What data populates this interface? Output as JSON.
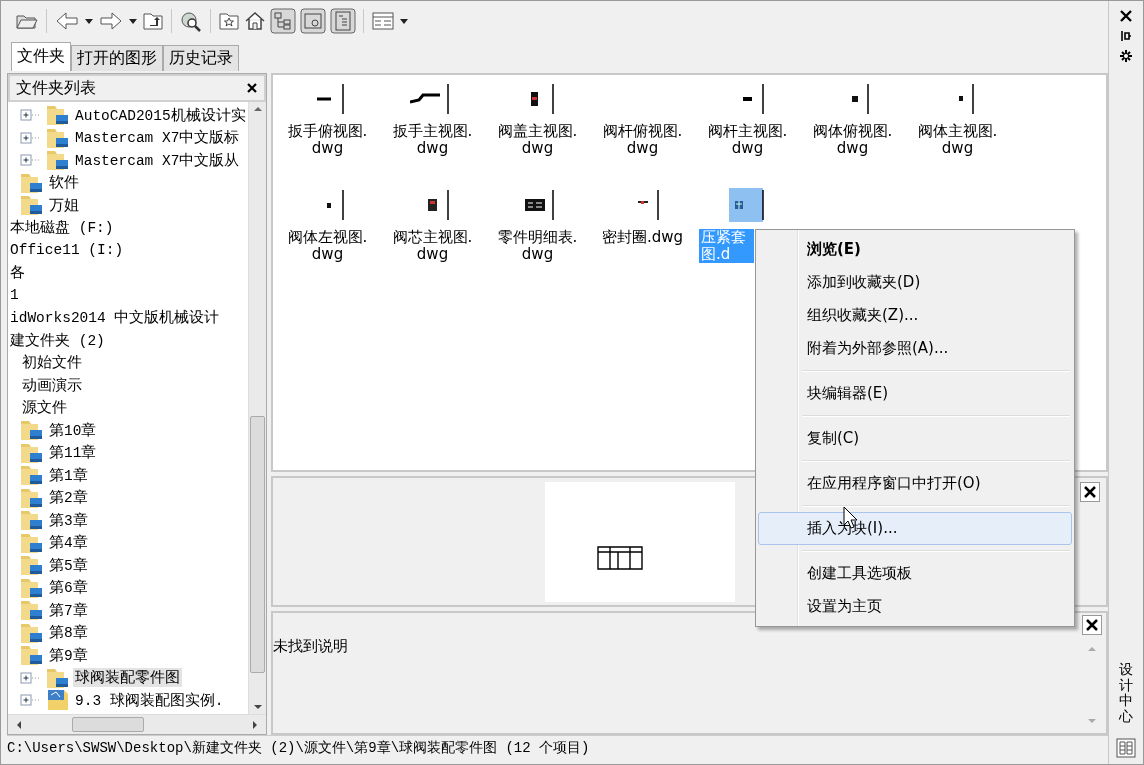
{
  "toolbar": {
    "toggles": [
      {
        "pressed": true
      },
      {
        "pressed": true
      },
      {
        "pressed": true
      }
    ]
  },
  "tabs": [
    {
      "label": "文件夹",
      "selected": true
    },
    {
      "label": "打开的图形",
      "selected": false
    },
    {
      "label": "历史记录",
      "selected": false
    }
  ],
  "folder_pane": {
    "title": "文件夹列表"
  },
  "tree": {
    "items": [
      {
        "children": [
          {
            "children": [
              {
                "children": [
                  {
                    "label": "AutoCAD2015机械设计实",
                    "kind": "folder",
                    "expandable": true,
                    "selected": false
                  },
                  {
                    "label": "Mastercam X7中文版标",
                    "kind": "folder",
                    "expandable": true,
                    "selected": false
                  },
                  {
                    "label": "Mastercam X7中文版从",
                    "kind": "folder",
                    "expandable": true,
                    "selected": false
                  }
                ]
              },
              {
                "label": "软件",
                "kind": "folder",
                "selected": false
              },
              {
                "label": "万姐",
                "kind": "folder",
                "selected": false
              }
            ]
          }
        ]
      },
      {
        "label": "本地磁盘 (F:)",
        "selected": false
      },
      {
        "label": "Office11 (I:)",
        "selected": false
      },
      {
        "label": "各",
        "selected": false
      },
      {
        "label": "1",
        "selected": false
      },
      {
        "label": "idWorks2014 中文版机械设计",
        "selected": false
      },
      {
        "label": "建文件夹 (2)",
        "selected": false,
        "children": [
          {
            "label": "初始文件",
            "selected": false
          },
          {
            "label": "动画演示",
            "selected": false
          },
          {
            "label": "源文件",
            "selected": false,
            "children": [
              {
                "label": "第10章",
                "kind": "folder",
                "selected": false
              },
              {
                "label": "第11章",
                "kind": "folder",
                "selected": false
              },
              {
                "label": "第1章",
                "kind": "folder",
                "selected": false
              },
              {
                "label": "第2章",
                "kind": "folder",
                "selected": false
              },
              {
                "label": "第3章",
                "kind": "folder",
                "selected": false
              },
              {
                "label": "第4章",
                "kind": "folder",
                "selected": false
              },
              {
                "label": "第5章",
                "kind": "folder",
                "selected": false
              },
              {
                "label": "第6章",
                "kind": "folder",
                "selected": false
              },
              {
                "label": "第7章",
                "kind": "folder",
                "selected": false
              },
              {
                "label": "第8章",
                "kind": "folder",
                "selected": false
              },
              {
                "label": "第9章",
                "kind": "folder",
                "selected": false,
                "children": [
                  {
                    "label": "球阀装配零件图",
                    "kind": "folder",
                    "expandable": true,
                    "selected": true
                  },
                  {
                    "label": "9.3  球阀装配图实例.",
                    "kind": "drawing",
                    "expandable": true,
                    "selected": false
                  }
                ]
              }
            ]
          }
        ]
      }
    ]
  },
  "content": {
    "files": [
      {
        "label": "扳手俯视图.\ndwg",
        "selected": false
      },
      {
        "label": "扳手主视图.\ndwg",
        "selected": false
      },
      {
        "label": "阀盖主视图.\ndwg",
        "selected": false
      },
      {
        "label": "阀杆俯视图.\ndwg",
        "selected": false
      },
      {
        "label": "阀杆主视图.\ndwg",
        "selected": false
      },
      {
        "label": "阀体俯视图.\ndwg",
        "selected": false
      },
      {
        "label": "阀体主视图.\ndwg",
        "selected": false
      },
      {
        "label": "阀体左视图.\ndwg",
        "selected": false
      },
      {
        "label": "阀芯主视图.\ndwg",
        "selected": false
      },
      {
        "label": "零件明细表.\ndwg",
        "selected": false
      },
      {
        "label": "密封圈.dwg",
        "selected": false
      },
      {
        "label": "压紧套图.d",
        "selected": true
      }
    ]
  },
  "description": "未找到说明",
  "context_menu": {
    "groups": [
      [
        {
          "label": "浏览(E)",
          "default": true,
          "selected": false
        },
        {
          "label": "添加到收藏夹(D)",
          "default": false,
          "selected": false
        },
        {
          "label": "组织收藏夹(Z)...",
          "default": false,
          "selected": false
        },
        {
          "label": "附着为外部参照(A)...",
          "default": false,
          "selected": false
        }
      ],
      [
        {
          "label": "块编辑器(E)",
          "default": false,
          "selected": false
        }
      ],
      [
        {
          "label": "复制(C)",
          "default": false,
          "selected": false
        }
      ],
      [
        {
          "label": "在应用程序窗口中打开(O)",
          "default": false,
          "selected": false
        }
      ],
      [
        {
          "label": "插入为块(I)...",
          "default": false,
          "selected": true
        }
      ],
      [
        {
          "label": "创建工具选项板",
          "default": false,
          "selected": false
        },
        {
          "label": "设置为主页",
          "default": false,
          "selected": false
        }
      ]
    ]
  },
  "status_bar": "C:\\Users\\SWSW\\Desktop\\新建文件夹 (2)\\源文件\\第9章\\球阀装配零件图 (12 个项目)",
  "side_title": "设计中心"
}
